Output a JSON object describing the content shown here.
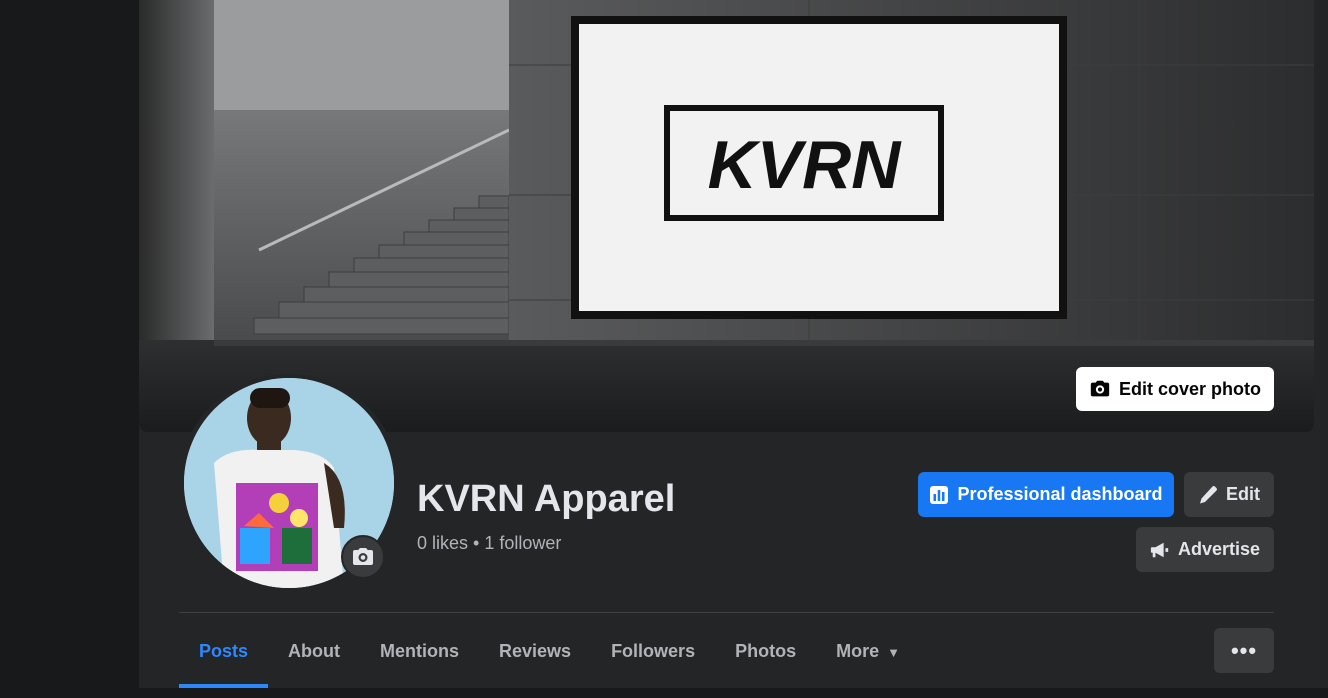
{
  "cover": {
    "edit_label": "Edit cover photo",
    "billboard_text": "KVRN",
    "camera_icon": "camera-icon"
  },
  "profile": {
    "name": "KVRN Apparel",
    "stats": "0 likes • 1 follower",
    "avatar_camera_icon": "camera-icon"
  },
  "actions": {
    "professional_dashboard": "Professional dashboard",
    "edit": "Edit",
    "advertise": "Advertise"
  },
  "tabs": [
    {
      "label": "Posts",
      "active": true
    },
    {
      "label": "About"
    },
    {
      "label": "Mentions"
    },
    {
      "label": "Reviews"
    },
    {
      "label": "Followers"
    },
    {
      "label": "Photos"
    },
    {
      "label": "More"
    }
  ],
  "more_options": "•••",
  "colors": {
    "accent": "#1877f2",
    "active_tab": "#2d88ff",
    "panel": "#242526",
    "background": "#18191a"
  }
}
